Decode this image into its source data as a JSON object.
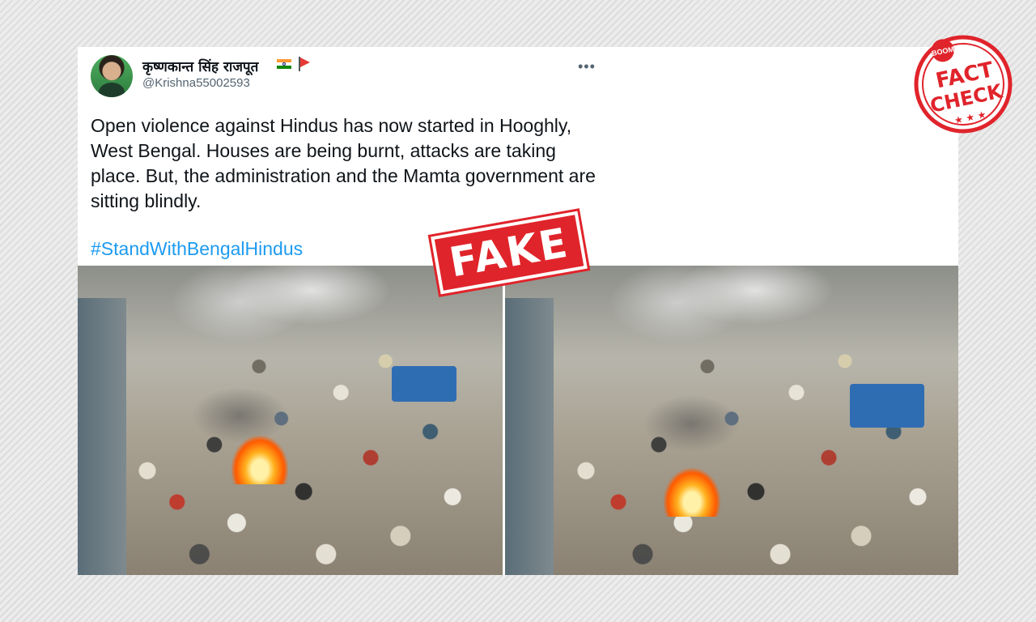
{
  "tweet": {
    "display_name": "कृष्णकान्त सिंह राजपूत",
    "handle": "@Krishna55002593",
    "more_icon": "more-horizontal-icon",
    "text": "Open violence against Hindus has now started in Hooghly, West Bengal. Houses are being burnt, attacks are taking place. But, the administration and the Mamta government are sitting blindly.",
    "hashtag": "#StandWithBengalHindus"
  },
  "overlays": {
    "fake_stamp": "FAKE",
    "fact_check_badge": {
      "brand": "BOOM",
      "line1": "FACT",
      "line2": "CHECK"
    }
  },
  "colors": {
    "hashtag": "#1d9bf0",
    "stamp_red": "#e0242b"
  }
}
